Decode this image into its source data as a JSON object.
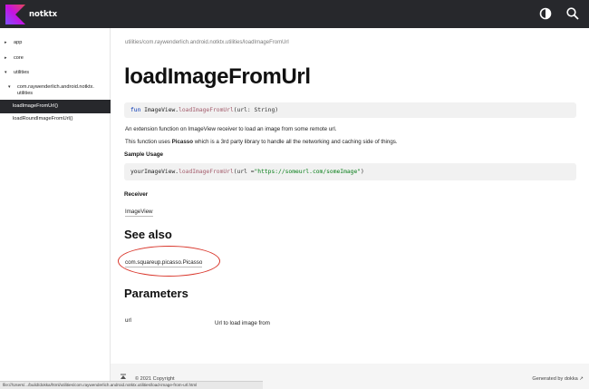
{
  "header": {
    "brand": "notktx",
    "logo_colors": [
      "#7f52ff",
      "#c711e1",
      "#e44857"
    ]
  },
  "sidebar": {
    "items": [
      {
        "label": "app",
        "arrow": "▸"
      },
      {
        "label": "core",
        "arrow": "▸"
      },
      {
        "label": "utilities",
        "arrow": "▾"
      },
      {
        "label": "com.raywenderlich.android.notktx.\nutilities",
        "arrow": "▾"
      },
      {
        "label": "loadImageFromUrl()",
        "arrow": ""
      },
      {
        "label": "loadRoundImageFromUrl()",
        "arrow": ""
      }
    ]
  },
  "main": {
    "breadcrumb": "utilities/com.raywenderlich.android.notktx.utilities/loadImageFromUrl",
    "title": "loadImageFromUrl",
    "signature": {
      "kw": "fun",
      "receiver": "ImageView.",
      "name": "loadImageFromUrl",
      "params": "(url: String)"
    },
    "description1": "An extension function on ImageView receiver to load an image from some remote url.",
    "description2_prefix": "This function uses ",
    "description2_bold": "Picasso",
    "description2_suffix": " which is a 3rd party library to handle all the networking and caching side of things.",
    "sample_usage_heading": "Sample Usage",
    "sample_code": {
      "receiver": "yourImageView.",
      "name": "loadImageFromUrl",
      "open": "(url = ",
      "string": "\"https://someurl.com/someImage\"",
      "close": ")"
    },
    "receiver_heading": "Receiver",
    "receiver_link": "ImageView",
    "see_also_heading": "See also",
    "see_also_link": "com.squareup.picasso.Picasso",
    "parameters_heading": "Parameters",
    "param_name": "url",
    "param_desc": "Url to load image from"
  },
  "footer": {
    "copyright": "© 2021 Copyright",
    "generated": "Generated by dokka ↗"
  },
  "status_url": "file:///Users/.../build/dokka/html/utilities/com.raywenderlich.android.notktx.utilities/load-image-from-url.html"
}
